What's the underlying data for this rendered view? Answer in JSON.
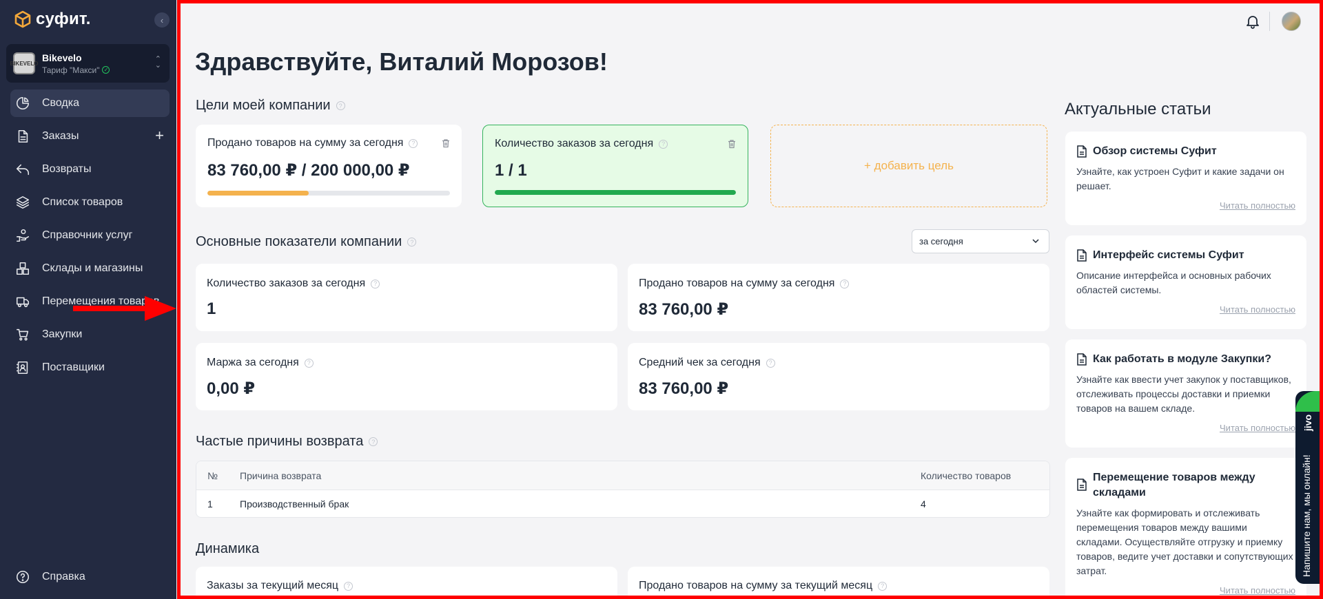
{
  "brand": {
    "name": "суфит."
  },
  "company": {
    "name": "Bikevelo",
    "plan": "Тариф \"Макси\"",
    "logo_text": "BIKEVELO"
  },
  "sidebar": {
    "items": [
      {
        "label": "Сводка",
        "icon": "pie-chart-icon",
        "active": true
      },
      {
        "label": "Заказы",
        "icon": "document-icon",
        "plus": "+"
      },
      {
        "label": "Возвраты",
        "icon": "return-arrow-icon"
      },
      {
        "label": "Список товаров",
        "icon": "layers-icon"
      },
      {
        "label": "Справочник услуг",
        "icon": "hand-service-icon"
      },
      {
        "label": "Склады и магазины",
        "icon": "boxes-icon"
      },
      {
        "label": "Перемещения товаров",
        "icon": "truck-icon"
      },
      {
        "label": "Закупки",
        "icon": "cart-icon"
      },
      {
        "label": "Поставщики",
        "icon": "contacts-icon"
      }
    ],
    "help": "Справка"
  },
  "greeting": "Здравствуйте, Виталий Морозов!",
  "goals": {
    "title": "Цели моей компании",
    "cards": [
      {
        "label": "Продано товаров на сумму за сегодня",
        "value": "83 760,00 ₽ / 200 000,00 ₽",
        "progress": 0.419,
        "color": "#f4b24d"
      },
      {
        "label": "Количество заказов за сегодня",
        "value": "1 / 1",
        "progress": 1.0,
        "color": "#22a94f"
      }
    ],
    "add_label": "+ добавить цель"
  },
  "metrics": {
    "title": "Основные показатели компании",
    "period": "за сегодня",
    "cards": [
      {
        "label": "Количество заказов за сегодня",
        "value": "1"
      },
      {
        "label": "Продано товаров на сумму за сегодня",
        "value": "83 760,00 ₽"
      },
      {
        "label": "Маржа за сегодня",
        "value": "0,00 ₽"
      },
      {
        "label": "Средний чек за сегодня",
        "value": "83 760,00 ₽"
      }
    ]
  },
  "returns": {
    "title": "Частые причины возврата",
    "columns": [
      "№",
      "Причина возврата",
      "Количество товаров"
    ],
    "rows": [
      [
        "1",
        "Производственный брак",
        "4"
      ]
    ]
  },
  "dynamics": {
    "title": "Динамика",
    "cards": [
      {
        "label": "Заказы за текущий месяц"
      },
      {
        "label": "Продано товаров на сумму за текущий месяц"
      }
    ]
  },
  "articles": {
    "title": "Актуальные статьи",
    "read_more": "Читать полностью",
    "items": [
      {
        "title": "Обзор системы Суфит",
        "text": "Узнайте, как устроен Суфит и какие задачи он решает."
      },
      {
        "title": "Интерфейс системы Суфит",
        "text": "Описание интерфейса и основных рабочих областей системы."
      },
      {
        "title": "Как работать в модуле Закупки?",
        "text": "Узнайте как ввести учет закупок у поставщиков, отслеживать процессы доставки и приемки товаров на вашем складе."
      },
      {
        "title": "Перемещение товаров между складами",
        "text": "Узнайте как формировать и отслеживать перемещения товаров между вашими складами. Осуществляйте отгрузку и приемку товаров, ведите учет доставки и сопутствующих затрат."
      }
    ]
  },
  "chat_widget": {
    "text": "Напишите нам, мы онлайн!",
    "brand": "jivo"
  }
}
